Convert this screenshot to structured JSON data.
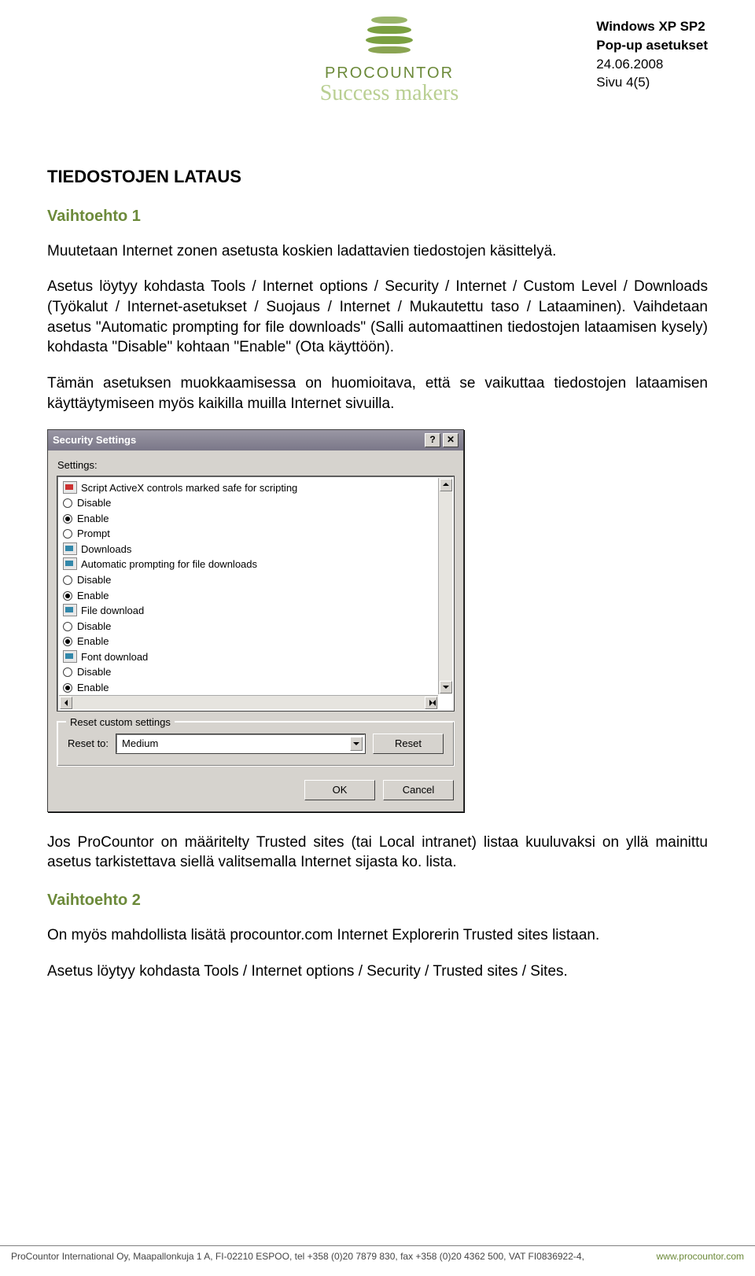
{
  "meta": {
    "line1": "Windows XP SP2",
    "line2": "Pop-up asetukset",
    "date": "24.06.2008",
    "page": "Sivu 4(5)"
  },
  "brand": {
    "name": "PROCOUNTOR",
    "slogan": "Success makers"
  },
  "headings": {
    "h1": "TIEDOSTOJEN LATAUS",
    "opt1": "Vaihtoehto 1",
    "opt2": "Vaihtoehto 2"
  },
  "paras": {
    "p1": "Muutetaan Internet zonen asetusta koskien ladattavien tiedostojen käsittelyä.",
    "p2": "Asetus löytyy kohdasta Tools / Internet options / Security / Internet / Custom Level / Downloads (Työkalut / Internet-asetukset / Suojaus / Internet / Mukautettu taso / Lataaminen). Vaihdetaan asetus \"Automatic prompting for file downloads\" (Salli automaattinen tiedostojen lataamisen kysely) kohdasta \"Disable\" kohtaan \"Enable\" (Ota käyttöön).",
    "p3": "Tämän asetuksen muokkaamisessa on huomioitava, että se vaikuttaa tiedostojen lataamisen käyttäytymiseen myös kaikilla muilla Internet sivuilla.",
    "p4": "Jos ProCountor on määritelty Trusted sites (tai Local intranet) listaa kuuluvaksi on yllä mainittu asetus tarkistettava siellä valitsemalla Internet sijasta ko. lista.",
    "p5": "On myös mahdollista lisätä procountor.com Internet Explorerin Trusted sites listaan.",
    "p6": "Asetus löytyy kohdasta Tools / Internet options / Security / Trusted sites / Sites."
  },
  "dialog": {
    "title": "Security Settings",
    "settings_label": "Settings:",
    "tree": [
      {
        "indent": 1,
        "icon": "ax",
        "label": "Script ActiveX controls marked safe for scripting"
      },
      {
        "indent": 2,
        "radio": true,
        "selected": false,
        "label": "Disable"
      },
      {
        "indent": 2,
        "radio": true,
        "selected": true,
        "label": "Enable"
      },
      {
        "indent": 2,
        "radio": true,
        "selected": false,
        "label": "Prompt"
      },
      {
        "indent": 0,
        "icon": "dl",
        "label": "Downloads"
      },
      {
        "indent": 1,
        "icon": "dl",
        "label": "Automatic prompting for file downloads"
      },
      {
        "indent": 2,
        "radio": true,
        "selected": false,
        "label": "Disable"
      },
      {
        "indent": 2,
        "radio": true,
        "selected": true,
        "label": "Enable"
      },
      {
        "indent": 1,
        "icon": "dl",
        "label": "File download"
      },
      {
        "indent": 2,
        "radio": true,
        "selected": false,
        "label": "Disable"
      },
      {
        "indent": 2,
        "radio": true,
        "selected": true,
        "label": "Enable"
      },
      {
        "indent": 1,
        "icon": "dl",
        "label": "Font download"
      },
      {
        "indent": 2,
        "radio": true,
        "selected": false,
        "label": "Disable"
      },
      {
        "indent": 2,
        "radio": true,
        "selected": true,
        "label": "Enable"
      }
    ],
    "fieldset": {
      "legend": "Reset custom settings",
      "reset_to_label": "Reset to:",
      "combo_value": "Medium",
      "reset_btn": "Reset"
    },
    "ok": "OK",
    "cancel": "Cancel"
  },
  "footer": {
    "text": "ProCountor International Oy, Maapallonkuja 1 A, FI-02210 ESPOO, tel +358 (0)20 7879 830, fax +358 (0)20 4362 500, VAT FI0836922-4,",
    "www": "www.procountor.com"
  }
}
